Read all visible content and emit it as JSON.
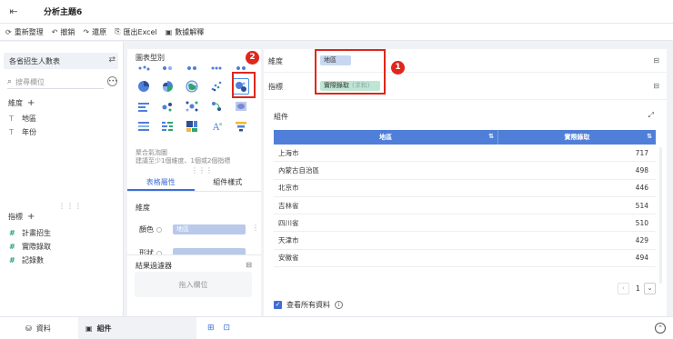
{
  "topbar": {
    "back_icon": "exit-icon",
    "title": "分析主題6"
  },
  "toolbar": {
    "items": [
      {
        "label": "重新整理",
        "icon": "⟳"
      },
      {
        "label": "撤銷",
        "icon": "↶"
      },
      {
        "label": "還原",
        "icon": "↷"
      },
      {
        "label": "匯出Excel",
        "icon": "⎘"
      },
      {
        "label": "數據解釋",
        "icon": "▣"
      }
    ]
  },
  "left": {
    "dataset": "各省招生人數表",
    "search_placeholder": "搜尋欄位",
    "dimension_header": "維度",
    "dimensions": [
      "地區",
      "年份"
    ],
    "measure_header": "指標",
    "measures": [
      "計畫招生",
      "實際錄取",
      "記錄數"
    ]
  },
  "chart_panel": {
    "title": "圖表型別",
    "combo_line1": "聚合氣泡圖",
    "combo_line2": "建議至少1個維度、1個或2個指標",
    "tabs": [
      "表格屬性",
      "組件樣式"
    ],
    "prop_section": "維度",
    "prop_rows": [
      {
        "label": "顏色",
        "value": "地區"
      },
      {
        "label": "形狀",
        "value": ""
      }
    ]
  },
  "filter": {
    "title": "結果過濾器",
    "drop_text": "拖入欄位"
  },
  "right": {
    "dimension_label": "維度",
    "dimension_chip": "地區",
    "measure_label": "指標",
    "measure_chip": "實際錄取",
    "measure_agg": "(求和)",
    "component_title": "組件",
    "table": {
      "headers": [
        "地區",
        "實際錄取"
      ],
      "rows": [
        [
          "上海市",
          "717"
        ],
        [
          "內蒙古自治區",
          "498"
        ],
        [
          "北京市",
          "446"
        ],
        [
          "吉林省",
          "514"
        ],
        [
          "四川省",
          "510"
        ],
        [
          "天津市",
          "429"
        ],
        [
          "安徽省",
          "494"
        ]
      ]
    },
    "page": "1",
    "show_all": "查看所有資料"
  },
  "annotations": {
    "badge1": "1",
    "badge2": "2"
  },
  "bottom": {
    "tab_data": "資料",
    "tab_component": "組件"
  },
  "colors": {
    "accent": "#3d6fd6",
    "header": "#4f7fd8",
    "annotation": "#e0261b",
    "dim_chip": "#c9d8f2",
    "measure_chip": "#bfe6d3"
  }
}
